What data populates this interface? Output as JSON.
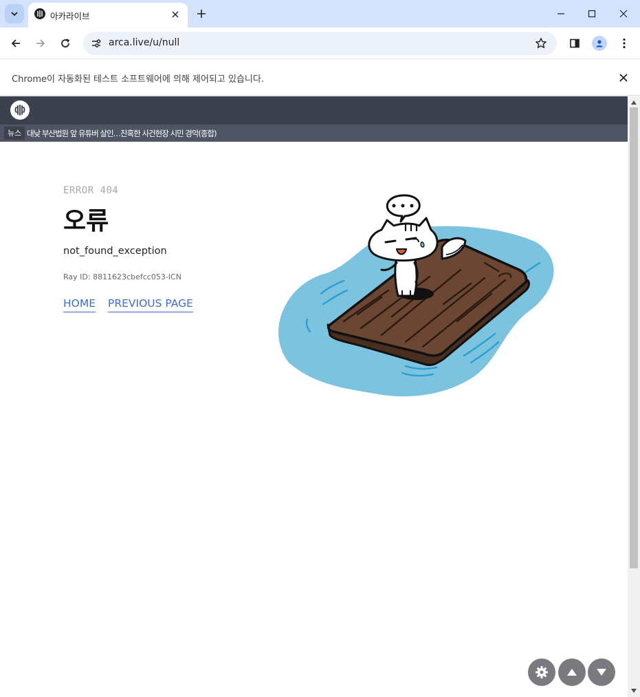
{
  "browser": {
    "tab": {
      "title": "아카라이브"
    },
    "url": "arca.live/u/null",
    "infobar": {
      "message": "Chrome이 자동화된 테스트 소프트웨어에 의해 제어되고 있습니다."
    },
    "icons": [
      "tab-search-icon",
      "site-favicon",
      "close-icon",
      "plus-icon",
      "minimize-icon",
      "maximize-icon",
      "back-arrow-icon",
      "forward-arrow-icon",
      "reload-icon",
      "site-settings-icon",
      "bookmark-star-icon",
      "side-panel-icon",
      "profile-icon",
      "more-menu-icon"
    ]
  },
  "site": {
    "news": {
      "badge": "뉴스",
      "headline": "대낮 부산법원 앞 유튜버 살인…잔혹한 사건현장 시민 경악(종합)"
    }
  },
  "error": {
    "code": "ERROR 404",
    "title": "오류",
    "message": "not_found_exception",
    "ray_id": "Ray ID: 8811623cbefcc053-ICN",
    "links": {
      "home": "HOME",
      "previous": "PREVIOUS PAGE"
    }
  },
  "floating_buttons": [
    "gear-icon",
    "arrow-up-icon",
    "arrow-down-icon"
  ],
  "colors": {
    "tabstrip": "#d3e3fd",
    "site_nav": "#3d414d",
    "news_bar": "#505566",
    "link": "#3b6fc5",
    "water": "#7cc3df",
    "raft": "#6b4632"
  }
}
